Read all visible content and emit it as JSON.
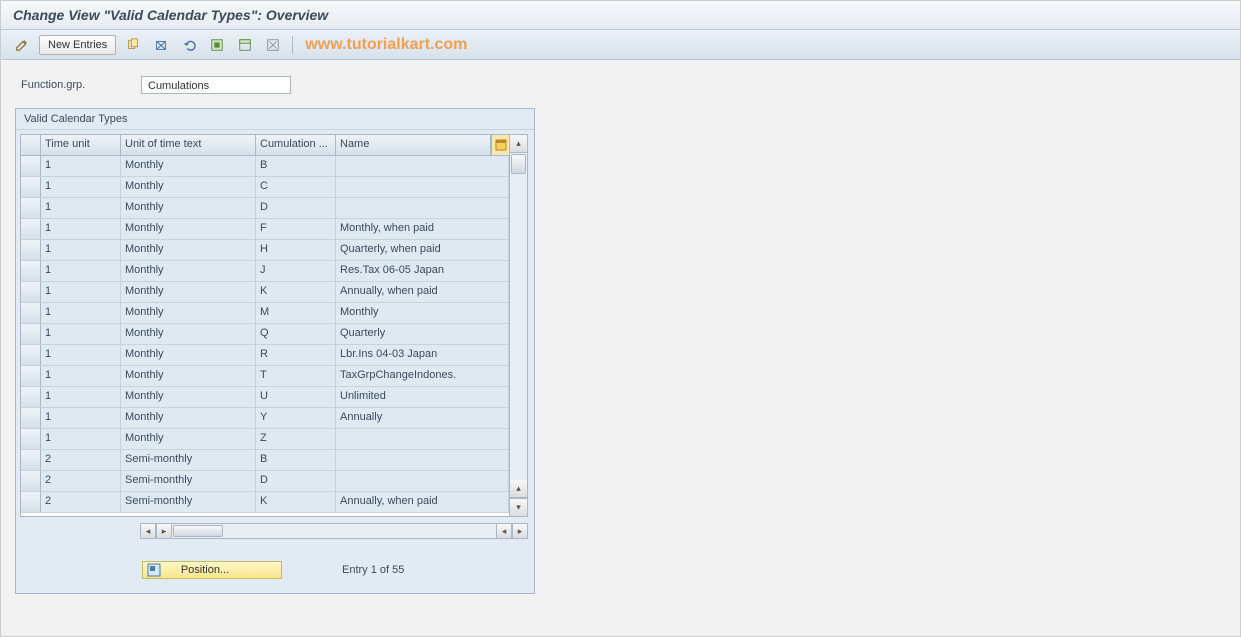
{
  "header": {
    "title": "Change View \"Valid Calendar Types\": Overview"
  },
  "toolbar": {
    "new_entries_label": "New Entries"
  },
  "watermark": "www.tutorialkart.com",
  "field": {
    "label": "Function.grp.",
    "value": "Cumulations"
  },
  "group": {
    "title": "Valid Calendar Types"
  },
  "table": {
    "columns": {
      "c1": "Time unit",
      "c2": "Unit of time text",
      "c3": "Cumulation ...",
      "c4": "Name"
    },
    "rows": [
      {
        "c1": "1",
        "c2": "Monthly",
        "c3": "B",
        "c4": ""
      },
      {
        "c1": "1",
        "c2": "Monthly",
        "c3": "C",
        "c4": ""
      },
      {
        "c1": "1",
        "c2": "Monthly",
        "c3": "D",
        "c4": ""
      },
      {
        "c1": "1",
        "c2": "Monthly",
        "c3": "F",
        "c4": "Monthly, when paid"
      },
      {
        "c1": "1",
        "c2": "Monthly",
        "c3": "H",
        "c4": "Quarterly, when paid"
      },
      {
        "c1": "1",
        "c2": "Monthly",
        "c3": "J",
        "c4": "Res.Tax 06-05  Japan"
      },
      {
        "c1": "1",
        "c2": "Monthly",
        "c3": "K",
        "c4": "Annually, when paid"
      },
      {
        "c1": "1",
        "c2": "Monthly",
        "c3": "M",
        "c4": "Monthly"
      },
      {
        "c1": "1",
        "c2": "Monthly",
        "c3": "Q",
        "c4": "Quarterly"
      },
      {
        "c1": "1",
        "c2": "Monthly",
        "c3": "R",
        "c4": "Lbr.Ins 04-03  Japan"
      },
      {
        "c1": "1",
        "c2": "Monthly",
        "c3": "T",
        "c4": "TaxGrpChangeIndones."
      },
      {
        "c1": "1",
        "c2": "Monthly",
        "c3": "U",
        "c4": "Unlimited"
      },
      {
        "c1": "1",
        "c2": "Monthly",
        "c3": "Y",
        "c4": "Annually"
      },
      {
        "c1": "1",
        "c2": "Monthly",
        "c3": "Z",
        "c4": ""
      },
      {
        "c1": "2",
        "c2": "Semi-monthly",
        "c3": "B",
        "c4": ""
      },
      {
        "c1": "2",
        "c2": "Semi-monthly",
        "c3": "D",
        "c4": ""
      },
      {
        "c1": "2",
        "c2": "Semi-monthly",
        "c3": "K",
        "c4": "Annually, when paid"
      }
    ]
  },
  "footer": {
    "position_label": "Position...",
    "entry_text": "Entry 1 of 55"
  }
}
